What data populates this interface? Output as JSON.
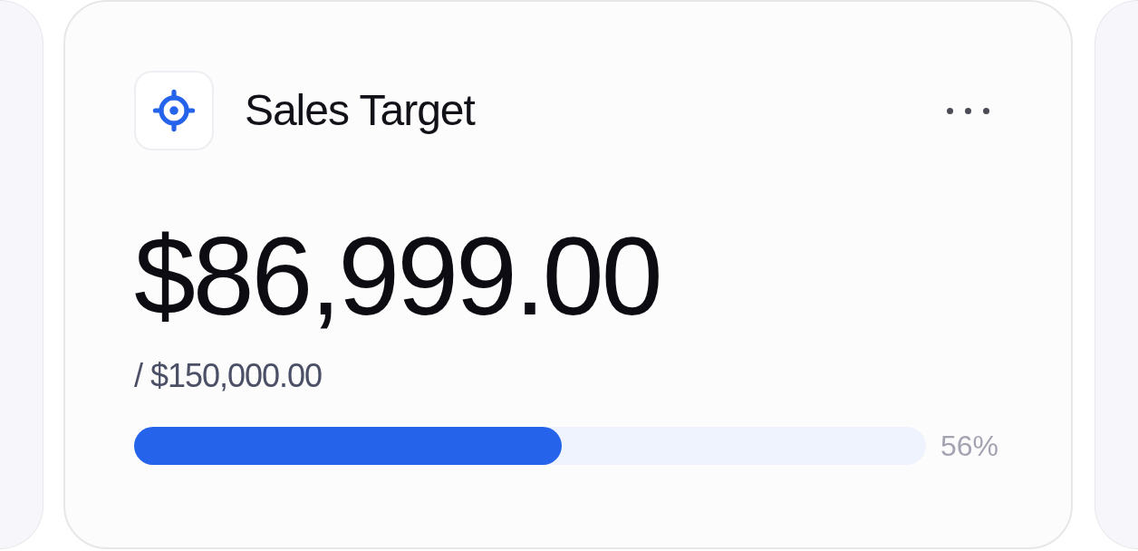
{
  "card": {
    "title": "Sales Target",
    "amount": "$86,999.00",
    "target": "/ $150,000.00",
    "progress": {
      "level": 0.54,
      "reading": "56%"
    }
  }
}
